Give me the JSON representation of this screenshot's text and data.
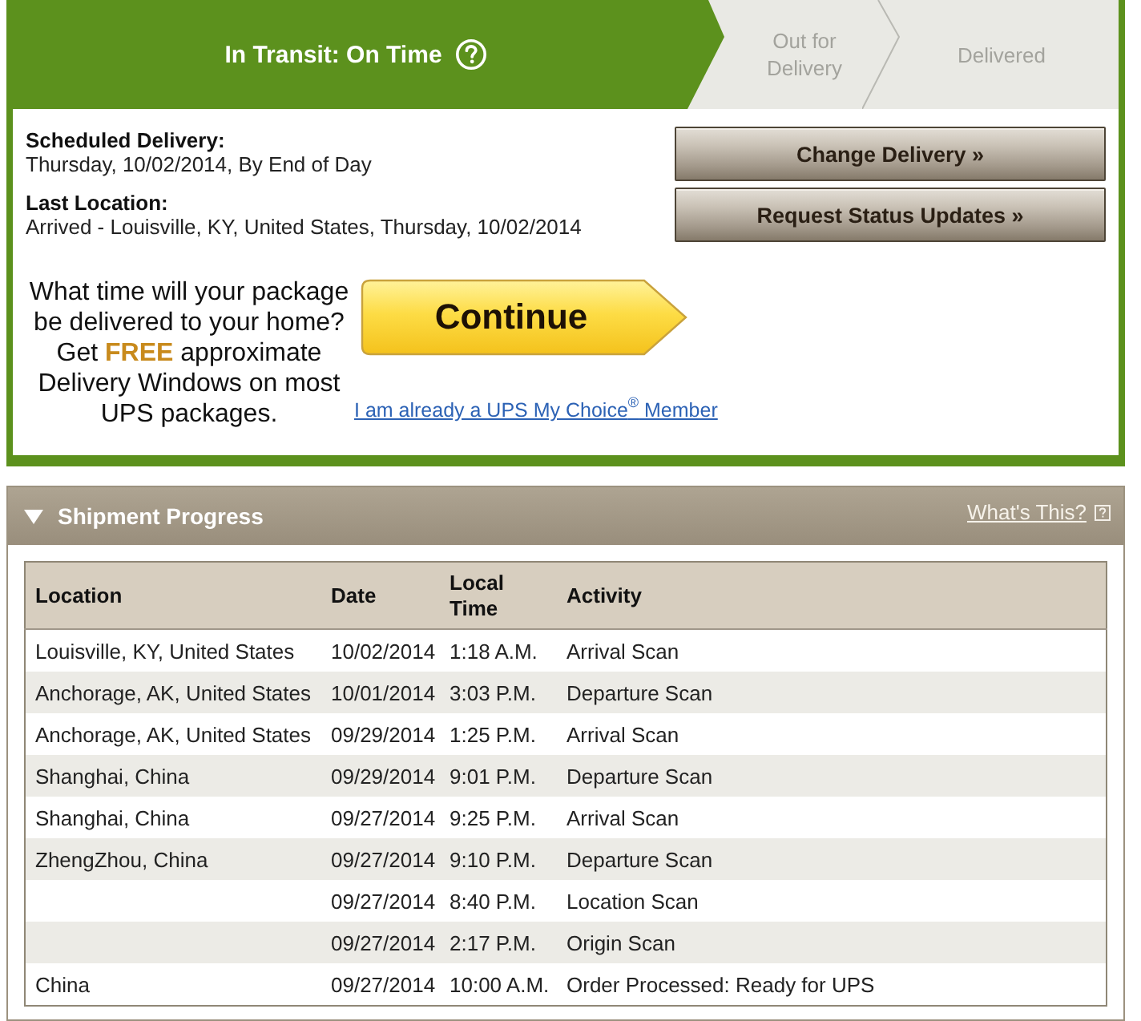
{
  "progress": {
    "steps": [
      {
        "label": "In Transit: On Time",
        "selected": true
      },
      {
        "label": "Out for Delivery",
        "selected": false
      },
      {
        "label": "Delivered",
        "selected": false
      }
    ]
  },
  "summary": {
    "fields": [
      {
        "label": "Scheduled Delivery:",
        "value": "Thursday, 10/02/2014, By End of Day"
      },
      {
        "label": "Last Location:",
        "value": "Arrived - Louisville, KY, United States, Thursday, 10/02/2014"
      }
    ],
    "actions": [
      "Change Delivery »",
      "Request Status Updates »"
    ]
  },
  "promo": {
    "text": "What time will your package be delivered to your home? Get **FREE** approximate Delivery Windows on most UPS packages.",
    "button": "Continue",
    "link": "I am already a UPS My Choice$^{®}$ Member"
  },
  "shipment": {
    "title": "Shipment Progress",
    "expanded": true,
    "help_link": "What's This?",
    "table": {
      "columns": [
        "Location",
        "Date",
        "Local Time",
        "Activity"
      ],
      "rows": [
        {
          "location": "Louisville, KY, United States",
          "date": "10/02/2014",
          "local_time": "1:18 A.M.",
          "activity": "Arrival Scan"
        },
        {
          "location": "Anchorage, AK, United States",
          "date": "10/01/2014",
          "local_time": "3:03 P.M.",
          "activity": "Departure Scan"
        },
        {
          "location": "Anchorage, AK, United States",
          "date": "09/29/2014",
          "local_time": "1:25 P.M.",
          "activity": "Arrival Scan"
        },
        {
          "location": "Shanghai, China",
          "date": "09/29/2014",
          "local_time": "9:01 P.M.",
          "activity": "Departure Scan"
        },
        {
          "location": "Shanghai, China",
          "date": "09/27/2014",
          "local_time": "9:25 P.M.",
          "activity": "Arrival Scan"
        },
        {
          "location": "ZhengZhou, China",
          "date": "09/27/2014",
          "local_time": "9:10 P.M.",
          "activity": "Departure Scan"
        },
        {
          "date": "09/27/2014",
          "local_time": "8:40 P.M.",
          "activity": "Location Scan"
        },
        {
          "date": "09/27/2014",
          "local_time": "2:17 P.M.",
          "activity": "Origin Scan"
        },
        {
          "location": "China",
          "date": "09/27/2014",
          "local_time": "10:00 A.M.",
          "activity": "Order Processed: Ready for UPS"
        }
      ]
    }
  }
}
